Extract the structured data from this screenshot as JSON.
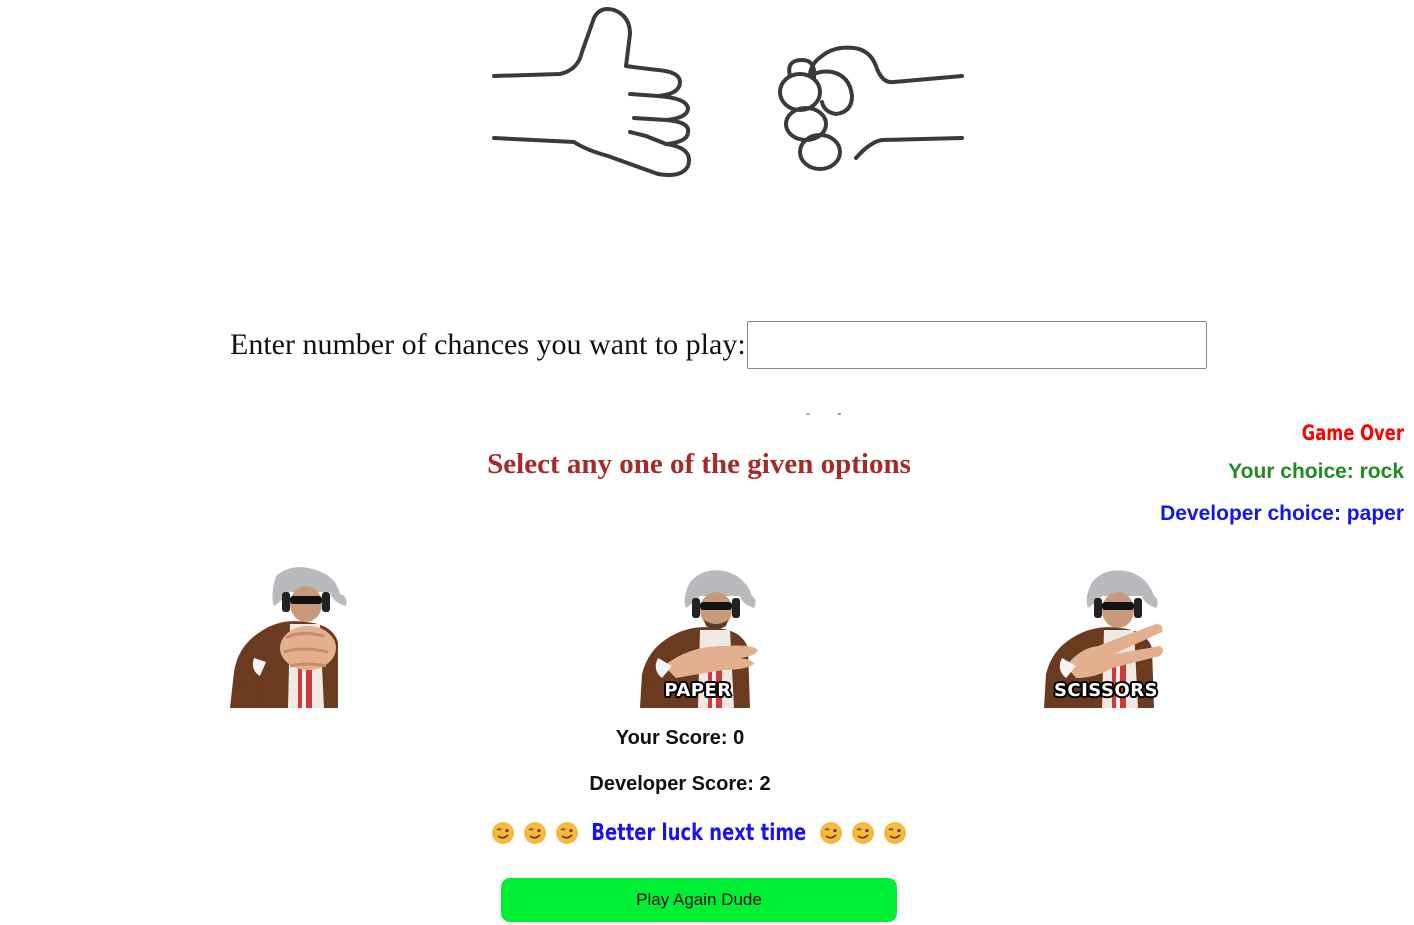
{
  "header": {
    "logo_icon": "rock-paper-hands-icon"
  },
  "chances": {
    "label": "Enter number of chances you want to play:",
    "value": "",
    "placeholder": ""
  },
  "status_dots": "- -",
  "prompt": {
    "heading": "Select any one of the given options"
  },
  "result": {
    "status": "Game Over",
    "your_choice": "Your choice: rock",
    "developer_choice": "Developer choice: paper",
    "colors": {
      "status": "#ff0000",
      "your_choice": "#1f8a1f",
      "developer_choice": "#1414f0"
    }
  },
  "options": [
    {
      "id": "rock",
      "caption": "",
      "icon": "rock-gesture-image"
    },
    {
      "id": "paper",
      "caption": "PAPER",
      "icon": "paper-gesture-image"
    },
    {
      "id": "scissors",
      "caption": "SCISSORS",
      "icon": "scissors-gesture-image"
    }
  ],
  "scores": {
    "your_score": "Your Score: 0",
    "developer_score": "Developer Score: 2"
  },
  "message": {
    "text": "Better luck next time",
    "emoji_icon": "winking-face-emoji",
    "emoji_count_each_side": 3
  },
  "actions": {
    "play_again_label": "Play Again Dude",
    "play_again_color": "#00ee33"
  }
}
